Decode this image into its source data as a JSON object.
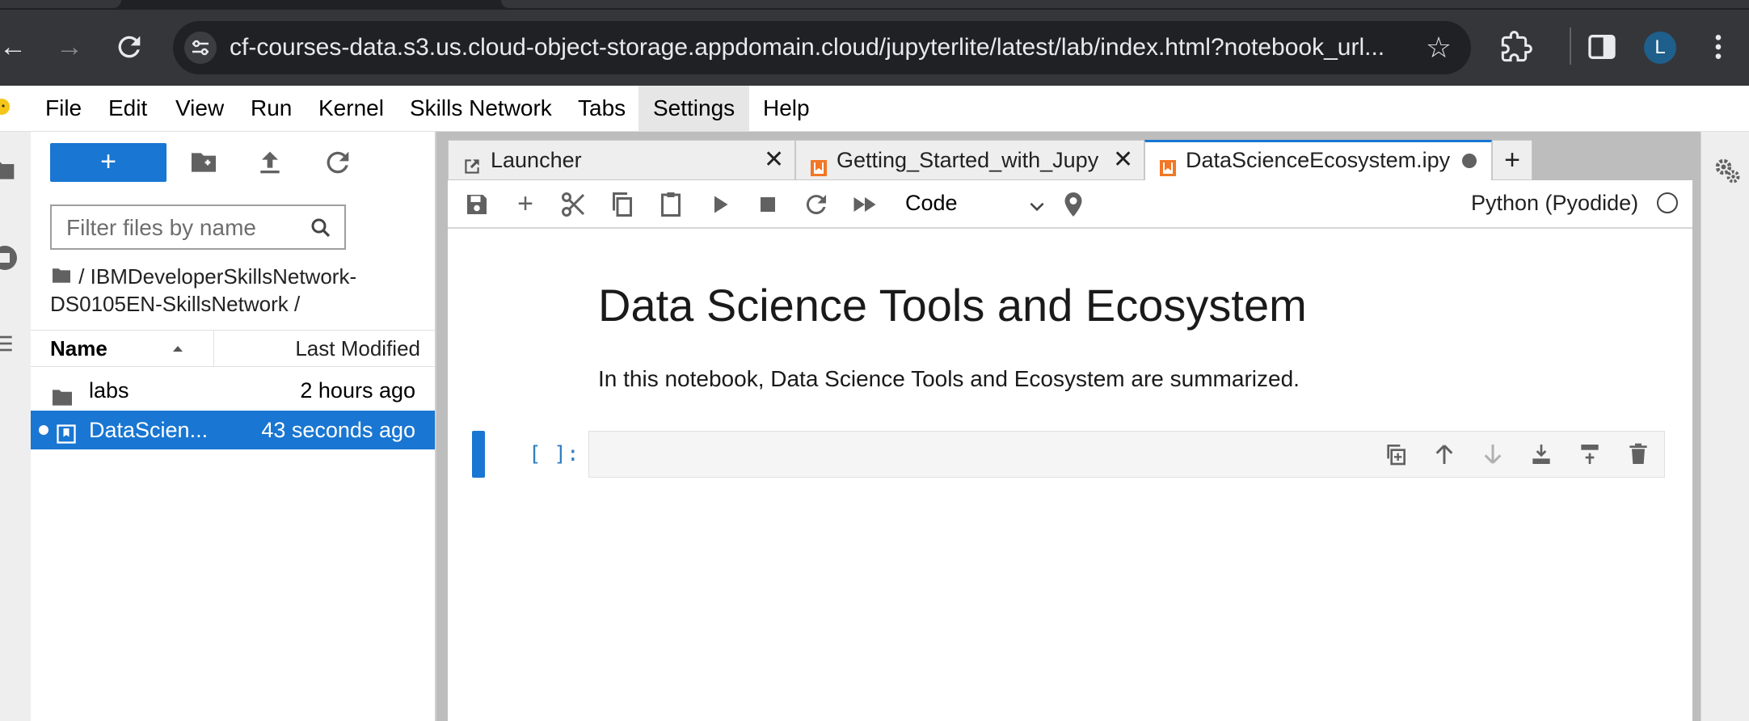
{
  "browser": {
    "url": "cf-courses-data.s3.us.cloud-object-storage.appdomain.cloud/jupyterlite/latest/lab/index.html?notebook_url...",
    "avatar_letter": "L"
  },
  "menubar": {
    "items": [
      "File",
      "Edit",
      "View",
      "Run",
      "Kernel",
      "Skills Network",
      "Tabs",
      "Settings",
      "Help"
    ],
    "active": "Settings"
  },
  "filebrowser": {
    "new_label": "+",
    "filter_placeholder": "Filter files by name",
    "breadcrumb": "/ IBMDeveloperSkillsNetwork-DS0105EN-SkillsNetwork /",
    "columns": {
      "name": "Name",
      "modified": "Last Modified"
    },
    "rows": [
      {
        "name": "labs",
        "modified": "2 hours ago",
        "type": "folder",
        "selected": false
      },
      {
        "name": "DataScien...",
        "modified": "43 seconds ago",
        "type": "notebook",
        "selected": true
      }
    ]
  },
  "tabs": [
    {
      "label": "Launcher",
      "icon": "launcher-icon",
      "current": false
    },
    {
      "label": "Getting_Started_with_Jupy",
      "icon": "notebook-icon",
      "current": false
    },
    {
      "label": "DataScienceEcosystem.ipy",
      "icon": "notebook-icon",
      "current": true,
      "unsaved": true
    }
  ],
  "add_tab_label": "+",
  "toolbar": {
    "cell_type": "Code",
    "kernel": "Python (Pyodide)"
  },
  "notebook": {
    "title": "Data Science Tools and Ecosystem",
    "text": "In this notebook, Data Science Tools and Ecosystem are summarized.",
    "prompt": "[ ]:"
  },
  "colors": {
    "accent": "#1976d2",
    "chrome_bg": "#35363a",
    "jupyter_orange": "#f37726"
  }
}
